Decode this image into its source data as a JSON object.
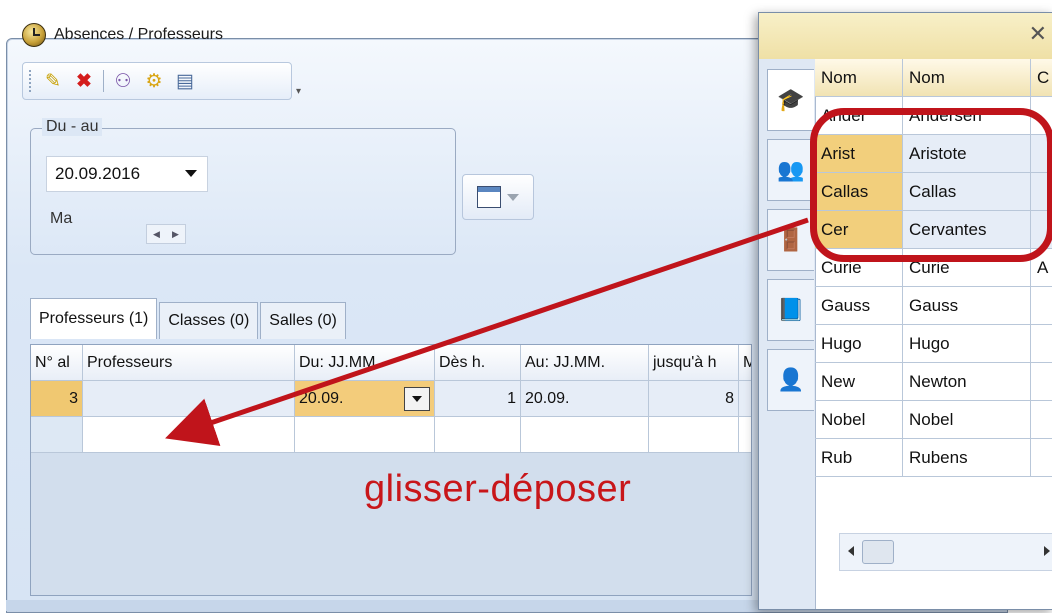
{
  "window": {
    "title": "Absences / Professeurs"
  },
  "toolbar": {
    "icons": [
      "new-icon",
      "delete-icon",
      "users-icon",
      "settings-icon",
      "clipboard-icon"
    ]
  },
  "date_range": {
    "group_label": "Du - au",
    "date_value": "20.09.2016",
    "day_label": "Ma"
  },
  "tabs": [
    {
      "label": "Professeurs (1)"
    },
    {
      "label": "Classes (0)"
    },
    {
      "label": "Salles (0)"
    }
  ],
  "grid": {
    "headers": [
      "N° al",
      "Professeurs",
      "Du: JJ.MM.",
      "Dès h.",
      "Au: JJ.MM.",
      "jusqu'à h",
      "M"
    ],
    "rows": [
      {
        "no": "3",
        "prof": "",
        "du": "20.09.",
        "des": "1",
        "au": "20.09.",
        "jusqua": "8"
      }
    ]
  },
  "drag_label": "glisser-déposer",
  "popup": {
    "close": "✕",
    "headers": [
      "Nom",
      "Nom",
      "C"
    ],
    "rows": [
      {
        "short": "Ander",
        "name": "Andersen",
        "extra": ""
      },
      {
        "short": "Arist",
        "name": "Aristote",
        "extra": ""
      },
      {
        "short": "Callas",
        "name": "Callas",
        "extra": ""
      },
      {
        "short": "Cer",
        "name": "Cervantes",
        "extra": ""
      },
      {
        "short": "Curie",
        "name": "Curie",
        "extra": "A"
      },
      {
        "short": "Gauss",
        "name": "Gauss",
        "extra": ""
      },
      {
        "short": "Hugo",
        "name": "Hugo",
        "extra": ""
      },
      {
        "short": "New",
        "name": "Newton",
        "extra": ""
      },
      {
        "short": "Nobel",
        "name": "Nobel",
        "extra": ""
      },
      {
        "short": "Rub",
        "name": "Rubens",
        "extra": ""
      }
    ]
  },
  "colors": {
    "accent_red": "#c0141b",
    "selection": "#f2cf7c"
  }
}
